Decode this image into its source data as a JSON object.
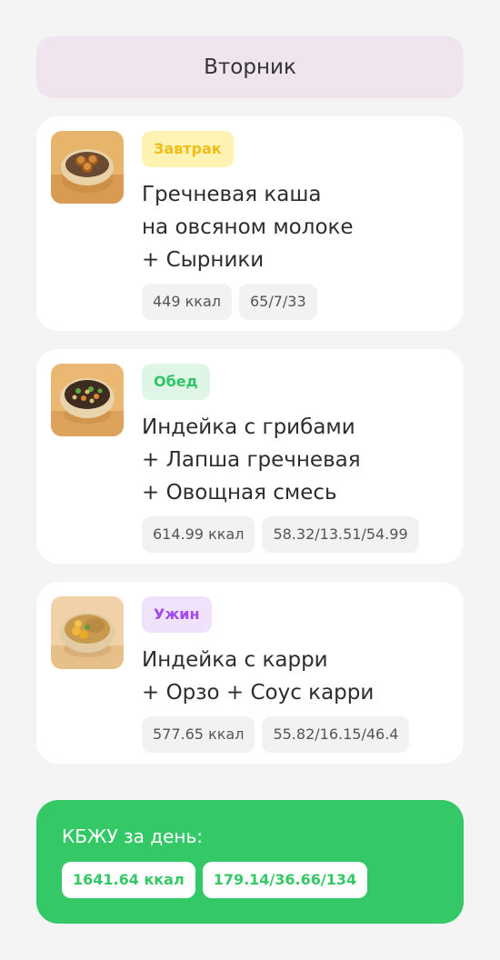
{
  "day": {
    "title": "Вторник"
  },
  "meals": [
    {
      "tag": "Завтрак",
      "tag_color": "#f1bd14",
      "tag_bg": "#fff3b3",
      "image": "buckwheat-syrniki-bowl",
      "dish_lines": [
        "Гречневая каша",
        "на овсяном молоке",
        "+ Сырники"
      ],
      "calories": "449 ккал",
      "macros": "65/7/33"
    },
    {
      "tag": "Обед",
      "tag_color": "#2fc466",
      "tag_bg": "#dff6e7",
      "image": "turkey-mushroom-noodle-bowl",
      "dish_lines": [
        "Индейка с грибами",
        "+ Лапша гречневая",
        "+ Овощная смесь"
      ],
      "calories": "614.99 ккал",
      "macros": "58.32/13.51/54.99"
    },
    {
      "tag": "Ужин",
      "tag_color": "#a24bea",
      "tag_bg": "#f1e2fb",
      "image": "turkey-curry-orzo-bowl",
      "dish_lines": [
        "Индейка с карри",
        "+ Орзо + Соус карри"
      ],
      "calories": "577.65 ккал",
      "macros": "55.82/16.15/46.4"
    }
  ],
  "summary": {
    "title": "КБЖУ за день:",
    "calories": "1641.64 ккал",
    "macros": "179.14/36.66/134",
    "accent": "#34c866"
  }
}
